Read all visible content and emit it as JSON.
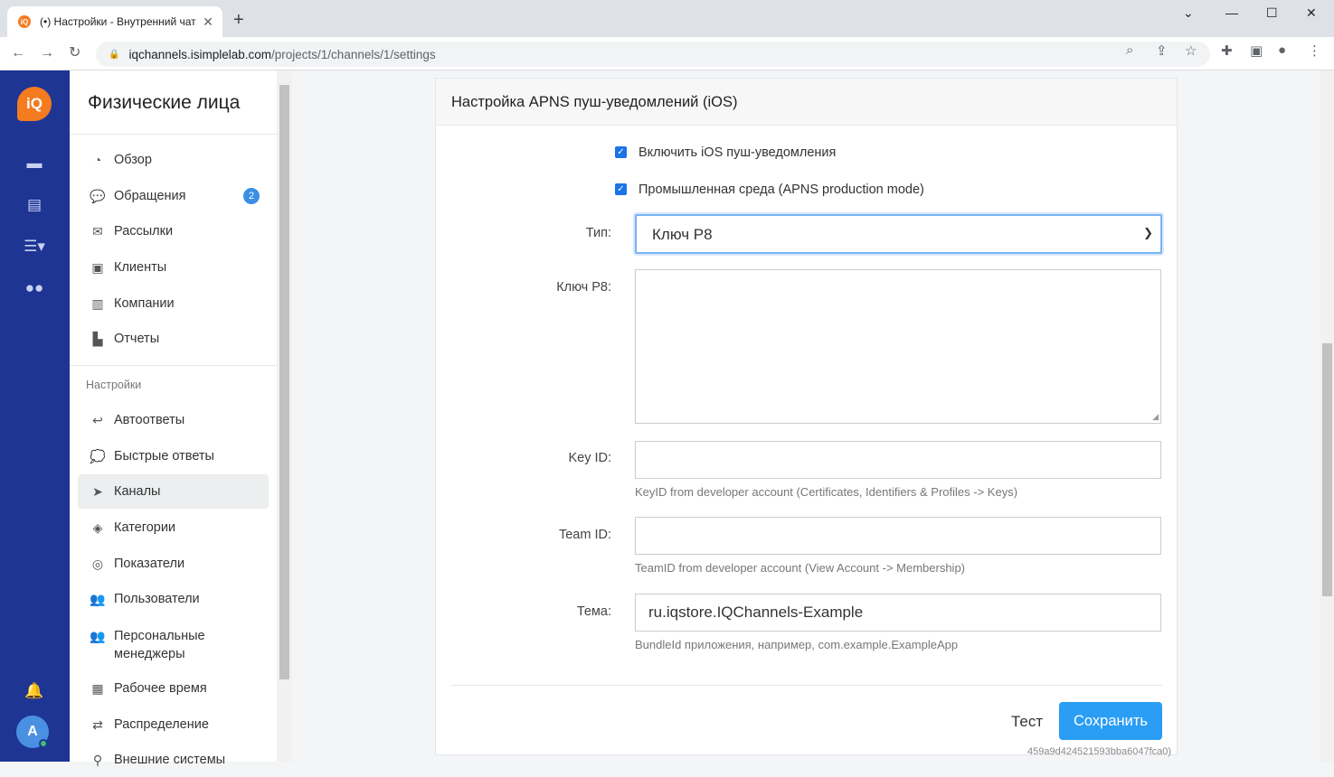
{
  "browser": {
    "tab_title": "(•) Настройки - Внутренний чат",
    "favicon": "iQ",
    "tab_close": "✕",
    "new_tab": "+",
    "url_host": "iqchannels.isimplelab.com",
    "url_path": "/projects/1/channels/1/settings"
  },
  "rail": {
    "logo": "iQ",
    "avatar_letter": "A"
  },
  "sidebar": {
    "title": "Физические лица",
    "items": [
      {
        "icon": "dashboard-icon",
        "label": "Обзор"
      },
      {
        "icon": "chat-icon",
        "label": "Обращения",
        "badge": "2"
      },
      {
        "icon": "mail-icon",
        "label": "Рассылки"
      },
      {
        "icon": "contact-card-icon",
        "label": "Клиенты"
      },
      {
        "icon": "building-icon",
        "label": "Компании"
      },
      {
        "icon": "chart-icon",
        "label": "Отчеты"
      }
    ],
    "section_label": "Настройки",
    "settings_items": [
      {
        "icon": "reply-all-icon",
        "label": "Автоответы"
      },
      {
        "icon": "speech-bubble-icon",
        "label": "Быстрые ответы"
      },
      {
        "icon": "paper-plane-icon",
        "label": "Каналы",
        "active": true
      },
      {
        "icon": "tag-icon",
        "label": "Категории"
      },
      {
        "icon": "target-icon",
        "label": "Показатели"
      },
      {
        "icon": "users-icon",
        "label": "Пользователи"
      },
      {
        "icon": "users-icon",
        "label": "Персональные менеджеры"
      },
      {
        "icon": "calendar-icon",
        "label": "Рабочее время"
      },
      {
        "icon": "arrows-swap-icon",
        "label": "Распределение"
      },
      {
        "icon": "plug-icon",
        "label": "Внешние системы"
      }
    ]
  },
  "card": {
    "title": "Настройка APNS пуш-уведомлений (iOS)",
    "checkbox_enable": {
      "label": "Включить iOS пуш-уведомления",
      "checked": true
    },
    "checkbox_production": {
      "label": "Промышленная среда (APNS production mode)",
      "checked": true
    },
    "type": {
      "label": "Тип:",
      "value": "Ключ P8"
    },
    "p8_key": {
      "label": "Ключ P8:",
      "value": ""
    },
    "key_id": {
      "label": "Key ID:",
      "value": "",
      "help": "KeyID from developer account (Certificates, Identifiers & Profiles -> Keys)"
    },
    "team_id": {
      "label": "Team ID:",
      "value": "",
      "help": "TeamID from developer account (View Account -> Membership)"
    },
    "topic": {
      "label": "Тема:",
      "value": "ru.iqstore.IQChannels-Example",
      "help": "BundleId приложения, например, com.example.ExampleApp"
    },
    "test_label": "Тест",
    "save_label": "Сохранить"
  },
  "footer": {
    "version": "459a9d424521593bba6047fca0)"
  },
  "colors": {
    "rail": "#1e3594",
    "accent": "#2a9df4",
    "logo": "#f47b20"
  }
}
